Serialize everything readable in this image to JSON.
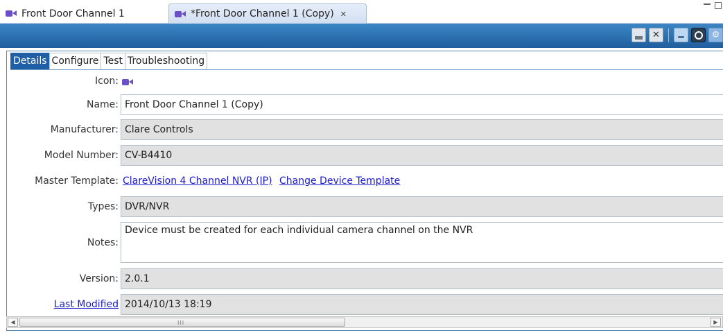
{
  "editor_tabs": [
    {
      "label": "Front Door Channel 1",
      "active": false
    },
    {
      "label": "*Front Door Channel 1 (Copy)",
      "active": true
    }
  ],
  "toolbar": {
    "icons": [
      "save-icon",
      "discard-icon",
      "device-icon",
      "camera-icon",
      "settings-icon"
    ]
  },
  "subtabs": [
    "Details",
    "Configure",
    "Test",
    "Troubleshooting"
  ],
  "active_subtab": "Details",
  "form": {
    "icon_label": "Icon:",
    "name_label": "Name:",
    "name_value": "Front Door Channel 1 (Copy)",
    "manufacturer_label": "Manufacturer:",
    "manufacturer_value": "Clare Controls",
    "model_label": "Model Number:",
    "model_value": "CV-B4410",
    "master_label": "Master Template:",
    "master_link": "ClareVision 4 Channel NVR (IP)",
    "change_link": "Change Device Template",
    "types_label": "Types:",
    "types_value": "DVR/NVR",
    "notes_label": "Notes:",
    "notes_value": "Device must be created for each individual camera channel on the NVR",
    "version_label": "Version:",
    "version_value": "2.0.1",
    "modified_label": "Last Modified",
    "modified_value": "2014/10/13 18:19"
  },
  "scrollbar": {
    "grip": "III"
  },
  "colors": {
    "accent": "#1f5fa6",
    "toolbar": "#2e74b6",
    "link": "#1a1acc",
    "readonly": "#e1e1e1"
  }
}
